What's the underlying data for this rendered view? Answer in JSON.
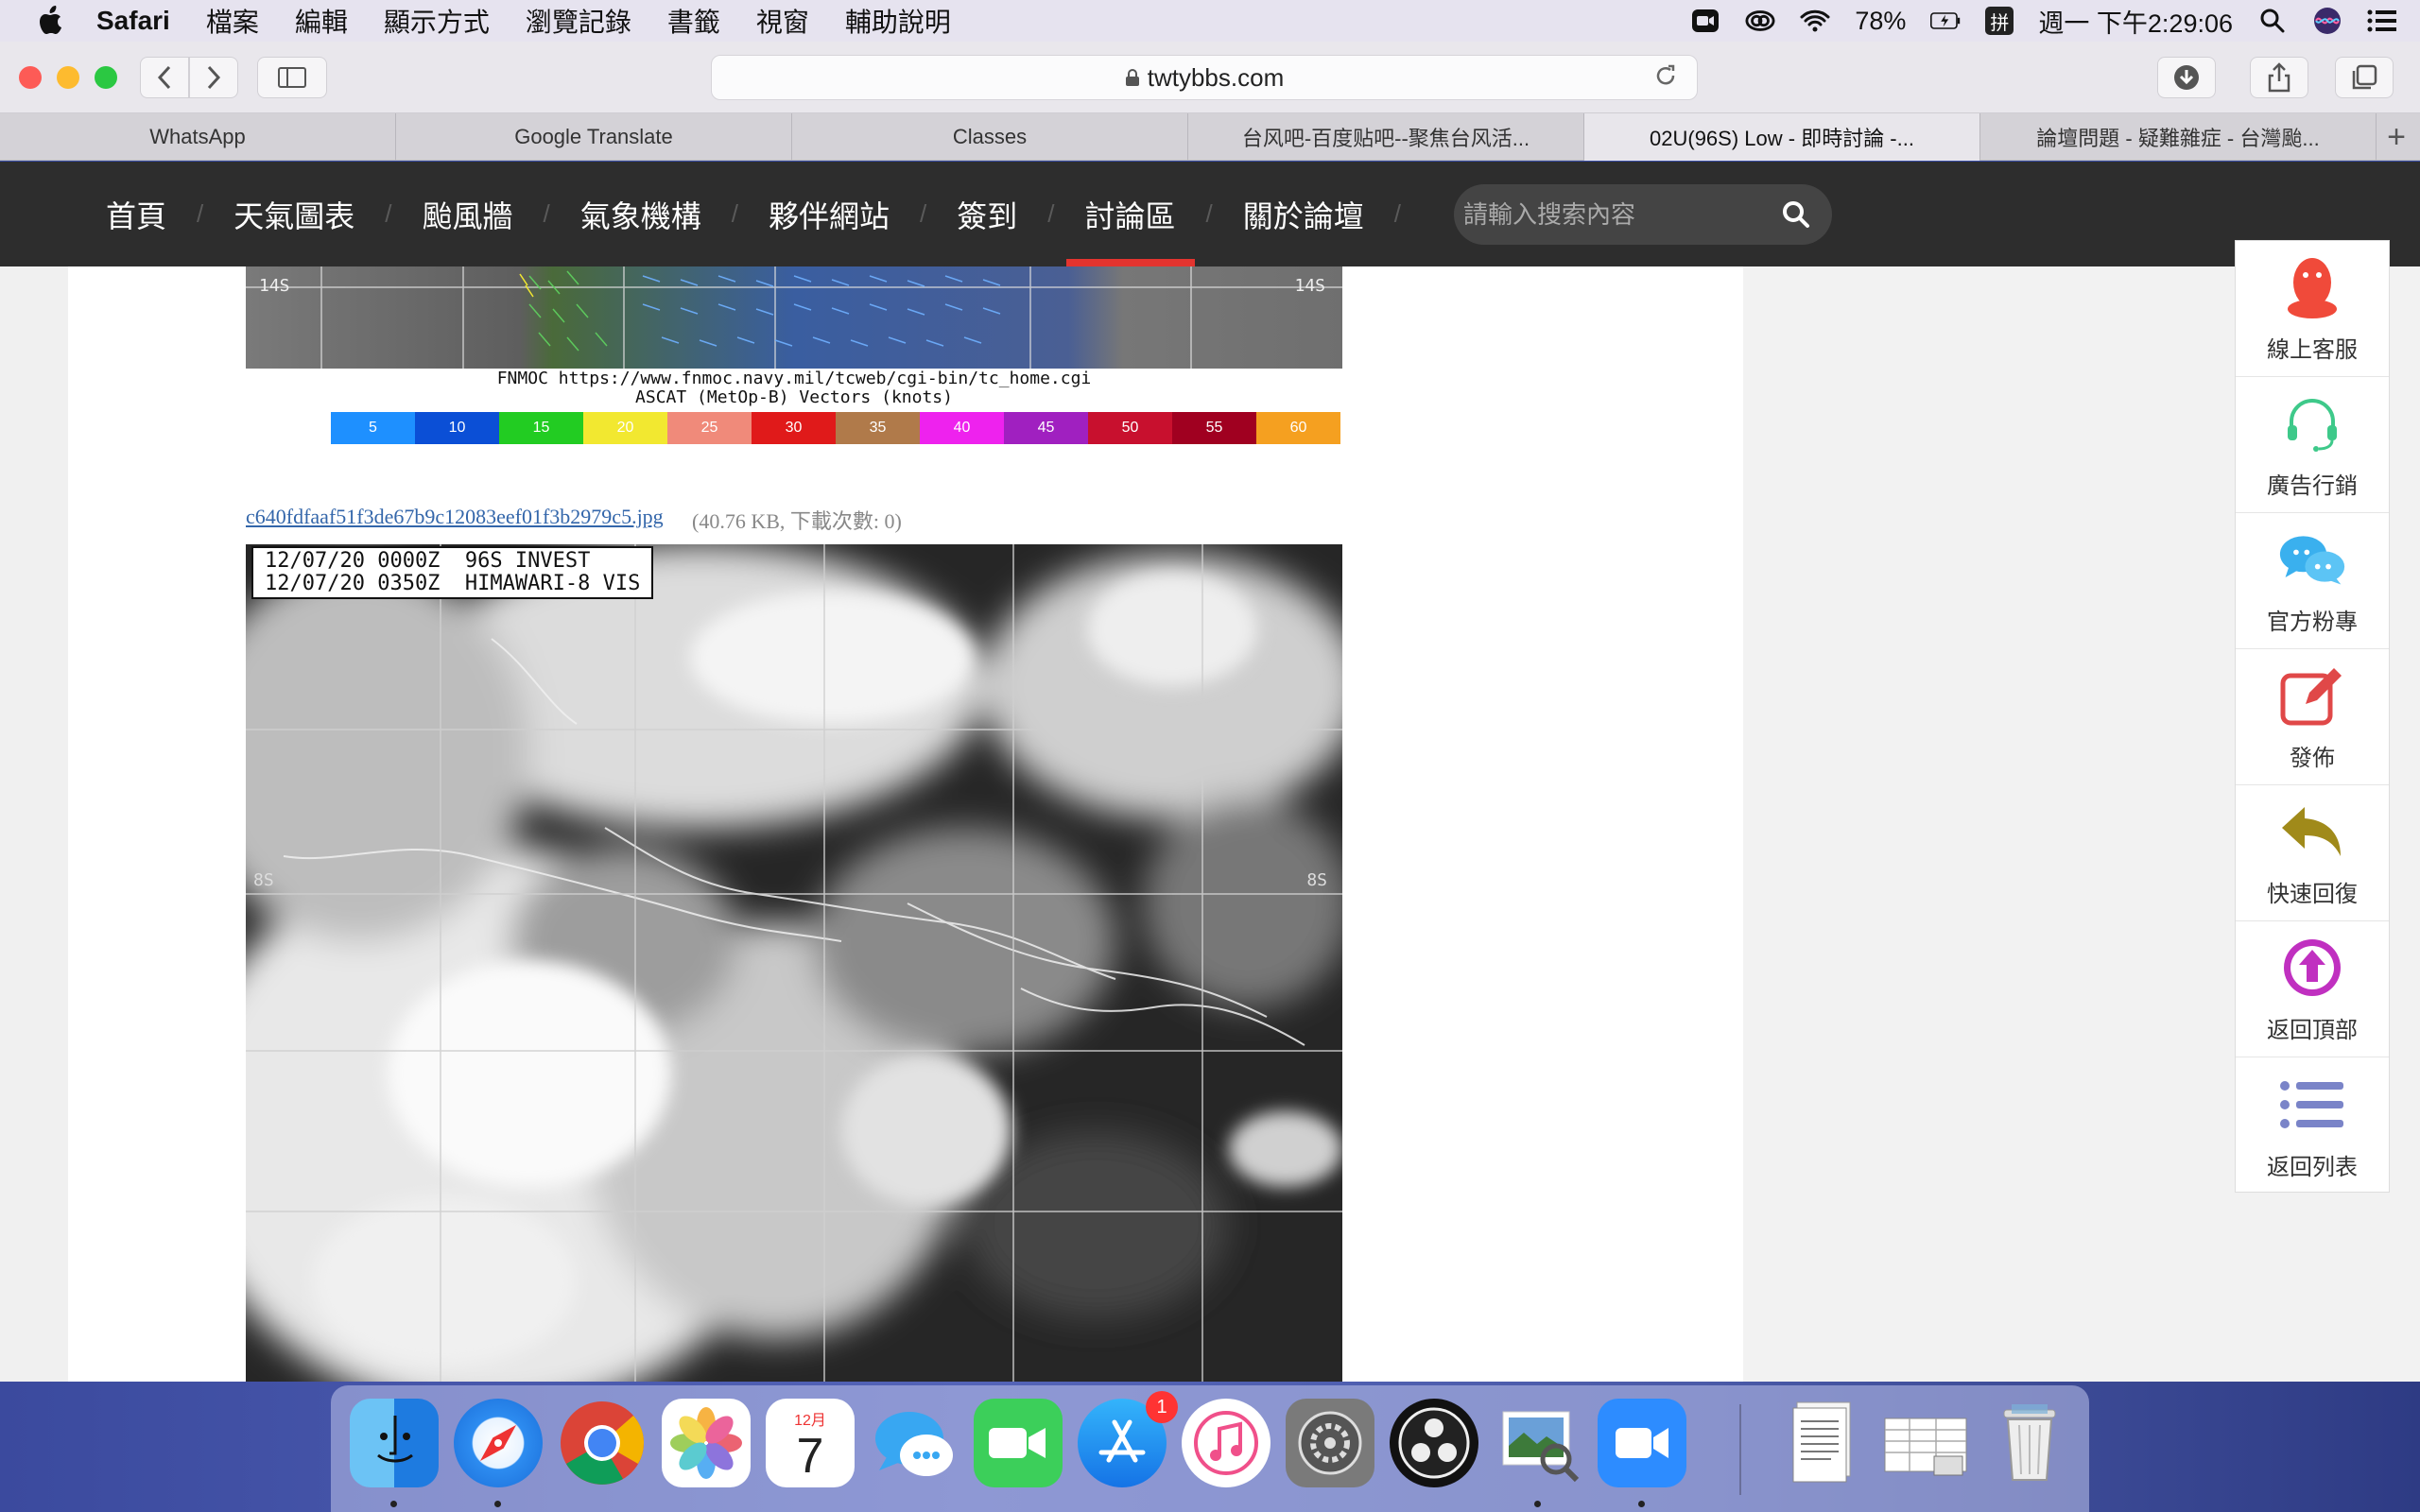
{
  "menubar": {
    "app": "Safari",
    "items": [
      "檔案",
      "編輯",
      "顯示方式",
      "瀏覽記錄",
      "書籤",
      "視窗",
      "輔助說明"
    ],
    "battery": "78%",
    "input_method": "拼",
    "clock": "週一 下午2:29:06"
  },
  "toolbar": {
    "url": "twtybbs.com"
  },
  "tabs": [
    {
      "label": "WhatsApp"
    },
    {
      "label": "Google Translate"
    },
    {
      "label": "Classes"
    },
    {
      "label": "台风吧-百度贴吧--聚焦台风活..."
    },
    {
      "label": "02U(96S) Low - 即時討論 -..."
    },
    {
      "label": "論壇問題 - 疑難雜症 - 台灣颱..."
    }
  ],
  "sitenav": {
    "items": [
      "首頁",
      "天氣圖表",
      "颱風牆",
      "氣象機構",
      "夥伴網站",
      "簽到",
      "討論區",
      "關於論壇"
    ],
    "active_index": 6,
    "search_placeholder": "請輸入搜索內容"
  },
  "ascat": {
    "lat_left": "14S",
    "lat_right": "14S",
    "credit_line1": "FNMOC https://www.fnmoc.navy.mil/tcweb/cgi-bin/tc_home.cgi",
    "credit_line2": "ASCAT (MetOp-B) Vectors (knots)",
    "colorbar": [
      {
        "label": "5",
        "color": "#1e90ff"
      },
      {
        "label": "10",
        "color": "#0b4fd6"
      },
      {
        "label": "15",
        "color": "#22cc22"
      },
      {
        "label": "20",
        "color": "#f2e830"
      },
      {
        "label": "25",
        "color": "#f08a7a"
      },
      {
        "label": "30",
        "color": "#e01a1a"
      },
      {
        "label": "35",
        "color": "#b07a4a"
      },
      {
        "label": "40",
        "color": "#ee22ee"
      },
      {
        "label": "45",
        "color": "#a020c0"
      },
      {
        "label": "50",
        "color": "#c8102e"
      },
      {
        "label": "55",
        "color": "#a00020"
      },
      {
        "label": "60",
        "color": "#f5a020"
      }
    ]
  },
  "attachment": {
    "filename": "c640fdfaaf51f3de67b9c12083eef01f3b2979c5.jpg",
    "meta": "(40.76 KB, 下載次數: 0)"
  },
  "satimage": {
    "label": "12/07/20 0000Z  96S INVEST\n12/07/20 0350Z  HIMAWARI-8 VIS",
    "lat_left": "8S",
    "lat_right": "8S"
  },
  "floatbar": [
    {
      "label": "線上客服",
      "icon": "penguin-icon",
      "color": "#f04a3a"
    },
    {
      "label": "廣告行銷",
      "icon": "headset-icon",
      "color": "#3ec98a"
    },
    {
      "label": "官方粉專",
      "icon": "chat-bubbles-icon",
      "color": "#3ab0ee"
    },
    {
      "label": "發佈",
      "icon": "edit-icon",
      "color": "#e04848"
    },
    {
      "label": "快速回復",
      "icon": "reply-icon",
      "color": "#a08a1a"
    },
    {
      "label": "返回頂部",
      "icon": "arrow-up-circle-icon",
      "color": "#c030c0"
    },
    {
      "label": "返回列表",
      "icon": "list-icon",
      "color": "#7a84c8"
    }
  ],
  "dock": {
    "calendar_month": "12月",
    "calendar_day": "7",
    "appstore_badge": "1"
  }
}
